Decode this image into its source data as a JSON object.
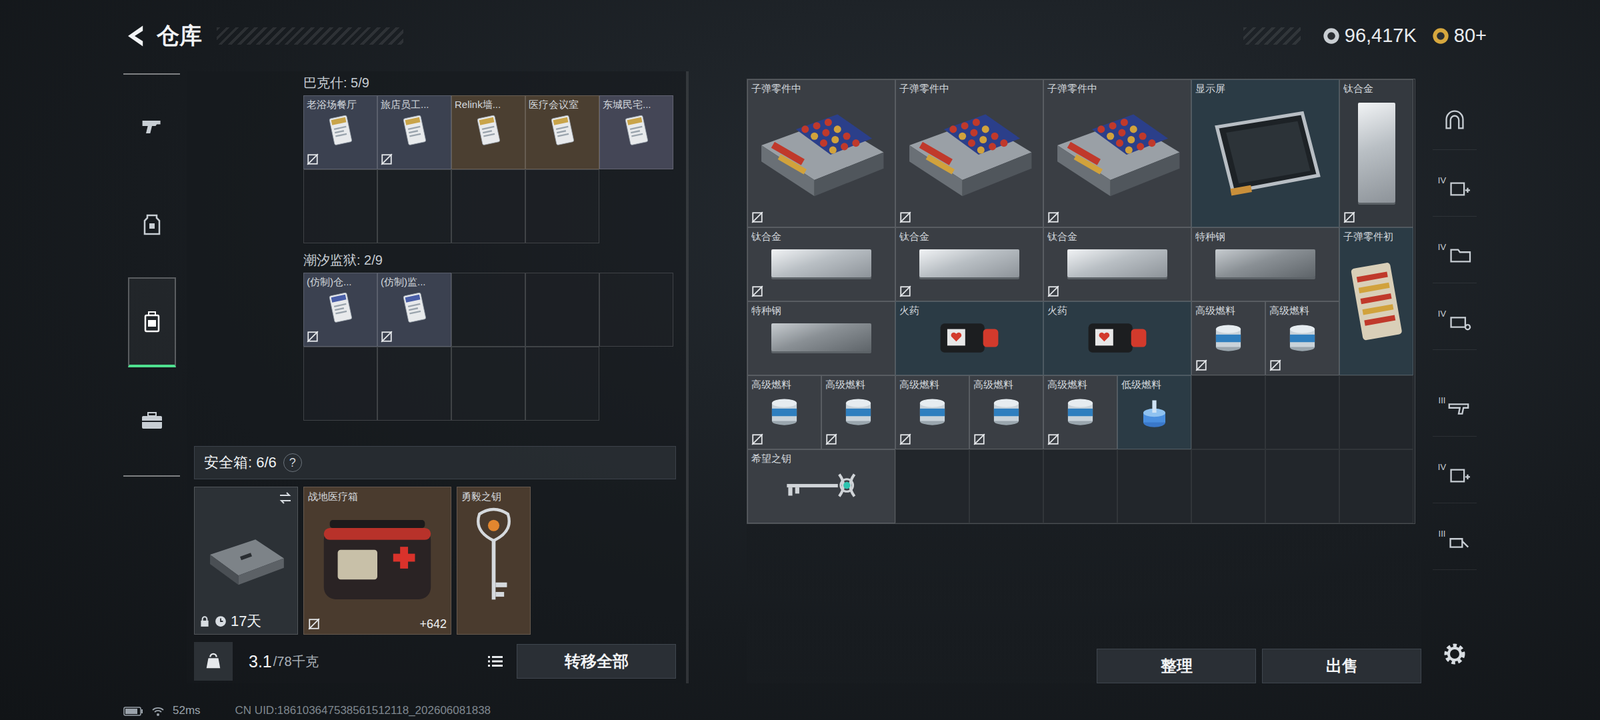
{
  "header": {
    "title": "仓库",
    "currencies": [
      {
        "value": "96,417K",
        "color": "#c9ced3"
      },
      {
        "value": "80+",
        "color": "#d6a73e"
      }
    ]
  },
  "nav": [
    {
      "selected": false
    },
    {
      "selected": false
    },
    {
      "selected": true
    },
    {
      "selected": false
    }
  ],
  "keyGroups": [
    {
      "title": "巴克什: 5/9",
      "slots": 9,
      "cards": [
        {
          "label": "老浴场餐厅",
          "kind": "card",
          "locked": true,
          "color": "#3b4150"
        },
        {
          "label": "旅店员工...",
          "kind": "card",
          "locked": true,
          "color": "#3b4150"
        },
        {
          "label": "Relink墙...",
          "kind": "card",
          "locked": false,
          "color": "#4b3f31"
        },
        {
          "label": "医疗会议室",
          "kind": "card",
          "locked": false,
          "color": "#4b3f31"
        },
        {
          "label": "东城民宅...",
          "kind": "card",
          "locked": false,
          "color": "#444656"
        }
      ]
    },
    {
      "title": "潮汐监狱: 2/9",
      "slots": 9,
      "cards": [
        {
          "label": "(仿制)仓...",
          "kind": "replica",
          "locked": true,
          "color": "#3b4150"
        },
        {
          "label": "(仿制)监...",
          "kind": "replica",
          "locked": true,
          "color": "#3b4150"
        }
      ]
    }
  ],
  "safeBox": {
    "label": "安全箱: 6/6",
    "help": "?",
    "case": {
      "days": "17天",
      "locked": true
    },
    "items": [
      {
        "name": "战地医疗箱",
        "kind": "medkit",
        "count": "+642",
        "locked": true,
        "color": "#4a3b2e"
      },
      {
        "name": "勇毅之钥",
        "kind": "key-gold",
        "locked": false,
        "color": "#4a3b2e"
      }
    ]
  },
  "capacity": {
    "current": "3.1",
    "max": "/78千克"
  },
  "transferAll": "转移全部",
  "stash": {
    "items": [
      {
        "name": "子弹零件中",
        "kind": "ammo-parts",
        "locked": true,
        "color": "#3a3e44"
      },
      {
        "name": "子弹零件中",
        "kind": "ammo-parts",
        "locked": true,
        "color": "#3a3e44"
      },
      {
        "name": "子弹零件中",
        "kind": "ammo-parts",
        "locked": true,
        "color": "#3a3e44"
      },
      {
        "name": "显示屏",
        "kind": "screen",
        "locked": false,
        "color": "#2b3b45"
      },
      {
        "name": "钛合金",
        "kind": "alloy",
        "locked": true,
        "color": "#34393f"
      },
      {
        "name": "钛合金",
        "kind": "alloy",
        "locked": true,
        "color": "#3a3e44"
      },
      {
        "name": "钛合金",
        "kind": "alloy",
        "locked": true,
        "color": "#3a3e44"
      },
      {
        "name": "钛合金",
        "kind": "alloy",
        "locked": true,
        "color": "#3a3e44"
      },
      {
        "name": "特种钢",
        "kind": "steel",
        "locked": false,
        "color": "#3a3e44"
      },
      {
        "name": "子弹零件初",
        "kind": "ammo-small",
        "locked": false,
        "color": "#2b3b45"
      },
      {
        "name": "特种钢",
        "kind": "steel",
        "locked": false,
        "color": "#3a3e44"
      },
      {
        "name": "火药",
        "kind": "powder",
        "locked": false,
        "color": "#2b3b45"
      },
      {
        "name": "火药",
        "kind": "powder",
        "locked": false,
        "color": "#2b3b45"
      },
      {
        "name": "高级燃料",
        "kind": "fuel",
        "locked": true,
        "color": "#3a3e44"
      },
      {
        "name": "高级燃料",
        "kind": "fuel",
        "locked": true,
        "color": "#3a3e44"
      },
      {
        "name": "高级燃料",
        "kind": "fuel",
        "locked": true,
        "color": "#3a3e44"
      },
      {
        "name": "高级燃料",
        "kind": "fuel",
        "locked": true,
        "color": "#3a3e44"
      },
      {
        "name": "高级燃料",
        "kind": "fuel",
        "locked": true,
        "color": "#3a3e44"
      },
      {
        "name": "高级燃料",
        "kind": "fuel",
        "locked": true,
        "color": "#3a3e44"
      },
      {
        "name": "高级燃料",
        "kind": "fuel",
        "locked": true,
        "color": "#3a3e44"
      },
      {
        "name": "低级燃料",
        "kind": "fuel-low",
        "locked": false,
        "color": "#2b3b45"
      },
      {
        "name": "希望之钥",
        "kind": "key-teal",
        "locked": false,
        "color": "#3a3e44"
      }
    ]
  },
  "actions": [
    "整理",
    "出售"
  ],
  "tools": [
    {
      "selected": false
    },
    {
      "mark": "IV",
      "selected": false
    },
    {
      "mark": "IV",
      "selected": false
    },
    {
      "mark": "IV",
      "selected": false
    },
    {
      "mark": "III",
      "selected": false
    },
    {
      "mark": "IV",
      "selected": false
    },
    {
      "mark": "III",
      "selected": false
    }
  ],
  "status": {
    "ping": "52ms",
    "uid": "CN UID:186103647538561512118_202606081838"
  }
}
